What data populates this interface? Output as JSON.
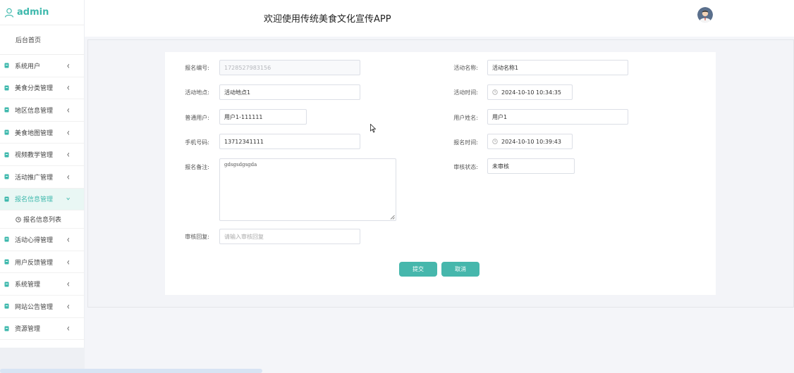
{
  "brand": {
    "name": "admin"
  },
  "header": {
    "title": "欢迎使用传统美食文化宣传APP"
  },
  "sidebar": {
    "home": "后台首页",
    "items": [
      {
        "label": "系统用户"
      },
      {
        "label": "美食分类管理"
      },
      {
        "label": "地区信息管理"
      },
      {
        "label": "美食地图管理"
      },
      {
        "label": "视频教学管理"
      },
      {
        "label": "活动推广管理"
      },
      {
        "label": "报名信息管理",
        "active": true
      },
      {
        "label": "活动心得管理"
      },
      {
        "label": "用户反馈管理"
      },
      {
        "label": "系统管理"
      },
      {
        "label": "网站公告管理"
      },
      {
        "label": "资源管理"
      }
    ],
    "submenu": {
      "label": "报名信息列表"
    }
  },
  "form": {
    "reg_no": {
      "label": "报名编号:",
      "value": "1728527983156"
    },
    "activity_name": {
      "label": "活动名称:",
      "value": "活动名称1"
    },
    "location": {
      "label": "活动地点:",
      "value": "活动地点1"
    },
    "activity_time": {
      "label": "活动时间:",
      "value": "2024-10-10 10:34:35"
    },
    "user": {
      "label": "普通用户:",
      "value": "用户1-111111"
    },
    "user_name": {
      "label": "用户姓名:",
      "value": "用户1"
    },
    "phone": {
      "label": "手机号码:",
      "value": "13712341111"
    },
    "reg_time": {
      "label": "报名时间:",
      "value": "2024-10-10 10:39:43"
    },
    "remark": {
      "label": "报名备注:",
      "value": "gdsgsdgsgda"
    },
    "status": {
      "label": "审核状态:",
      "value": "未审核"
    },
    "reply": {
      "label": "审核回复:",
      "placeholder": "请输入审核回复"
    },
    "submit": "提交",
    "cancel": "取消"
  },
  "colors": {
    "accent": "#3fb9ad",
    "button": "#46b7ac",
    "active_bg": "#e9f7f4"
  }
}
